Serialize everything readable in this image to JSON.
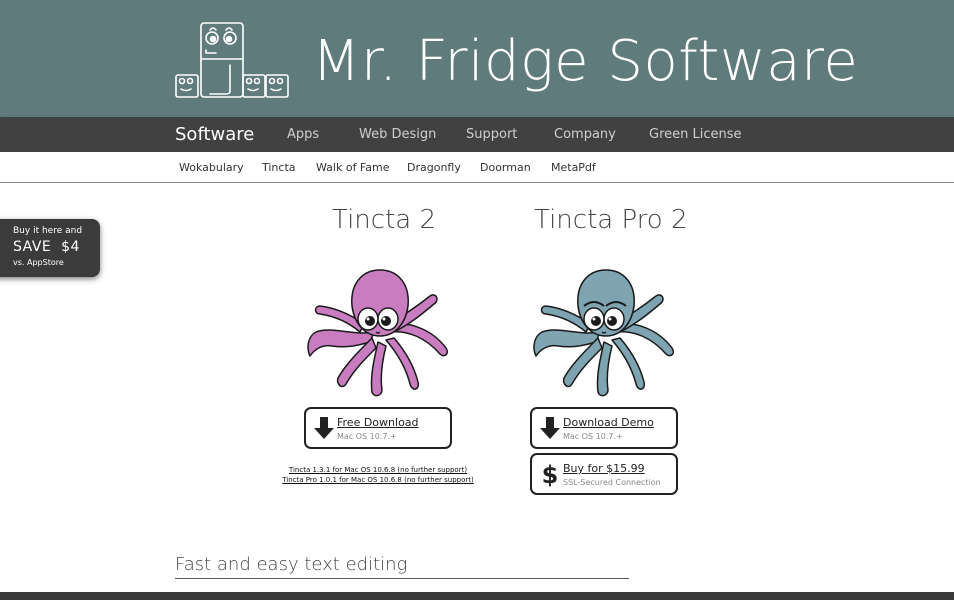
{
  "header": {
    "brand": "Mr. Fridge Software",
    "background_color": "#607b7c"
  },
  "main_nav": {
    "items": [
      {
        "label": "Software",
        "active": true
      },
      {
        "label": "Apps"
      },
      {
        "label": "Web Design"
      },
      {
        "label": "Support"
      },
      {
        "label": "Company"
      },
      {
        "label": "Green License"
      }
    ],
    "background_color": "#414141"
  },
  "sub_nav": {
    "items": [
      "Wokabulary",
      "Tincta",
      "Walk of Fame",
      "Dragonfly",
      "Doorman",
      "MetaPdf"
    ]
  },
  "promo": {
    "line1": "Buy it here and",
    "line2": "SAVE  $4",
    "line3": "vs. AppStore"
  },
  "products": [
    {
      "title": "Tincta 2",
      "octopus_color": "#c97cc0",
      "buttons": [
        {
          "icon": "download-arrow-icon",
          "label": "Free Download",
          "sublabel": "Mac OS 10.7.+"
        }
      ],
      "legacy_links": [
        "Tincta 1.3.1 for Mac OS 10.6.8 (no further support)",
        "Tincta Pro 1.0.1 for Mac OS 10.6.8 (no further support)"
      ]
    },
    {
      "title": "Tincta Pro 2",
      "octopus_color": "#7ea3b1",
      "buttons": [
        {
          "icon": "download-arrow-icon",
          "label": "Download Demo",
          "sublabel": "Mac OS 10.7.+"
        },
        {
          "icon": "dollar-icon",
          "label": "Buy for $15.99",
          "sublabel": "SSL-Secured Connection"
        }
      ]
    }
  ],
  "section": {
    "title": "Fast and easy text editing"
  }
}
